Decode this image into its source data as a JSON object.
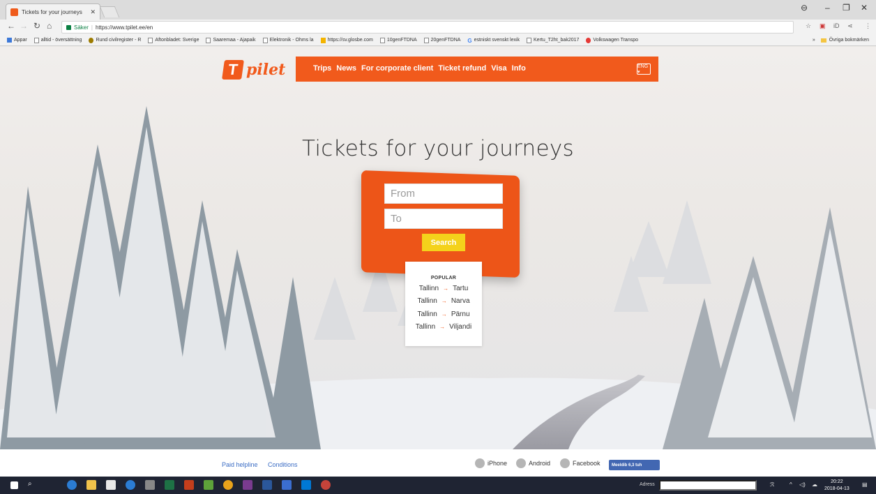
{
  "browser": {
    "tab_title": "Tickets for your journeys",
    "tab_close": "✕",
    "secure_label": "Säker",
    "url": "https://www.tpilet.ee/en",
    "bookmarks": [
      {
        "label": "Appar",
        "icon": "apps-icon"
      },
      {
        "label": "alltid - översättning",
        "icon": "page-icon"
      },
      {
        "label": "Rund civilregister - R",
        "icon": "favicon-icon"
      },
      {
        "label": "Aftonbladet: Sverige",
        "icon": "page-icon"
      },
      {
        "label": "Saaremaa - Ajapaik",
        "icon": "page-icon"
      },
      {
        "label": "Elektronik - Ohms la",
        "icon": "page-icon"
      },
      {
        "label": "https://sv.glosbe.com",
        "icon": "glosbe-icon"
      },
      {
        "label": "10genFTDNA",
        "icon": "page-icon"
      },
      {
        "label": "20genFTDNA",
        "icon": "page-icon"
      },
      {
        "label": "estniskt svenskt lexik",
        "icon": "google-icon"
      },
      {
        "label": "Kertu_T2ht_bak2017",
        "icon": "page-icon"
      },
      {
        "label": "Volkswagen Transpo",
        "icon": "vw-icon"
      }
    ],
    "other_bookmarks": "Övriga bokmärken"
  },
  "site": {
    "logo_text": "pilet",
    "logo_mark": "T",
    "nav": [
      "Trips",
      "News",
      "For corporate client",
      "Ticket refund",
      "Visa",
      "Info"
    ],
    "language": "ENG ▾",
    "hero_title": "Tickets for your journeys",
    "search": {
      "from_placeholder": "From",
      "to_placeholder": "To",
      "button": "Search"
    },
    "popular": {
      "heading": "POPULAR",
      "routes": [
        {
          "from": "Tallinn",
          "to": "Tartu"
        },
        {
          "from": "Tallinn",
          "to": "Narva"
        },
        {
          "from": "Tallinn",
          "to": "Pärnu"
        },
        {
          "from": "Tallinn",
          "to": "Viljandi"
        }
      ],
      "arrow": "→"
    },
    "footer": {
      "paid_helpline": "Paid helpline",
      "conditions": "Conditions",
      "iphone": "iPhone",
      "android": "Android",
      "facebook": "Facebook",
      "fb_like": "Meeldib 6,3 tuh"
    }
  },
  "taskbar": {
    "address_label": "Adress",
    "time": "20:22",
    "date": "2018-04-13"
  },
  "colors": {
    "brand_orange": "#f15a1c",
    "search_yellow": "#f4d21b"
  }
}
